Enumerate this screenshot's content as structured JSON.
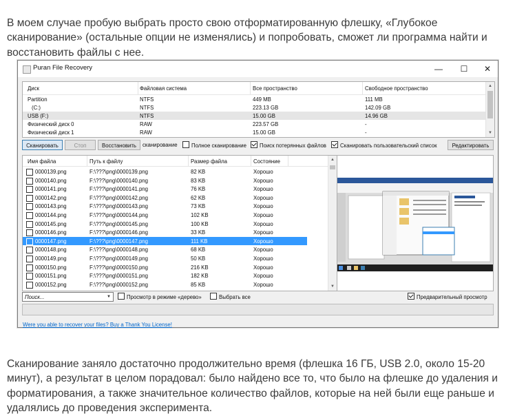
{
  "article": {
    "paragraph_1": "В моем случае пробую выбрать просто свою отформатированную флешку, «Глубокое сканирование» (остальные опции не изменялись) и попробовать, сможет ли программа найти и восстановить файлы с нее.",
    "paragraph_2": "Сканирование заняло достаточно продолжительно время (флешка 16 ГБ, USB 2.0, около 15-20 минут), а результат в целом порадовал: было найдено все то, что было на флешке до удаления и форматирования, а также значительное количество файлов, которые на ней были еще раньше и удалялись до проведения эксперимента."
  },
  "window": {
    "title": "Puran File Recovery",
    "minimize": "—",
    "maximize": "☐",
    "close": "✕"
  },
  "drives": {
    "columns": [
      "Диск",
      "Файловая система",
      "Все пространство",
      "Свободное пространство"
    ],
    "rows": [
      {
        "disk": "Partition",
        "fs": "NTFS",
        "total": "449 MB",
        "free": "111 MB"
      },
      {
        "disk": "(C:)",
        "fs": "NTFS",
        "total": "223.13 GB",
        "free": "142.09 GB"
      },
      {
        "disk": "USB (F:)",
        "fs": "NTFS",
        "total": "15.00 GB",
        "free": "14.96 GB"
      },
      {
        "disk": "Физический диск 0",
        "fs": "RAW",
        "total": "223.57 GB",
        "free": "-"
      },
      {
        "disk": "Физический диск 1",
        "fs": "RAW",
        "total": "15.00 GB",
        "free": "-"
      }
    ]
  },
  "toolbar": {
    "scan": "Сканировать",
    "stop": "Стоп",
    "restore": "Восстановить",
    "deep_scan": "сканирование",
    "full_scan": "Полное сканирование",
    "lost_files": "Поиск потерянных файлов",
    "custom_list": "Сканировать пользовательский список",
    "edit": "Редактировать"
  },
  "files": {
    "columns": [
      "Имя файла",
      "Путь к файлу",
      "Размер файла",
      "Состояние"
    ],
    "rows": [
      {
        "name": "0000139.png",
        "path": "F:\\???\\png\\0000139.png",
        "size": "82 KB",
        "state": "Хорошо"
      },
      {
        "name": "0000140.png",
        "path": "F:\\???\\png\\0000140.png",
        "size": "83 KB",
        "state": "Хорошо"
      },
      {
        "name": "0000141.png",
        "path": "F:\\???\\png\\0000141.png",
        "size": "76 KB",
        "state": "Хорошо"
      },
      {
        "name": "0000142.png",
        "path": "F:\\???\\png\\0000142.png",
        "size": "62 KB",
        "state": "Хорошо"
      },
      {
        "name": "0000143.png",
        "path": "F:\\???\\png\\0000143.png",
        "size": "73 KB",
        "state": "Хорошо"
      },
      {
        "name": "0000144.png",
        "path": "F:\\???\\png\\0000144.png",
        "size": "102 KB",
        "state": "Хорошо"
      },
      {
        "name": "0000145.png",
        "path": "F:\\???\\png\\0000145.png",
        "size": "100 KB",
        "state": "Хорошо"
      },
      {
        "name": "0000146.png",
        "path": "F:\\???\\png\\0000146.png",
        "size": "33 KB",
        "state": "Хорошо"
      },
      {
        "name": "0000147.png",
        "path": "F:\\???\\png\\0000147.png",
        "size": "111 KB",
        "state": "Хорошо"
      },
      {
        "name": "0000148.png",
        "path": "F:\\???\\png\\0000148.png",
        "size": "68 KB",
        "state": "Хорошо"
      },
      {
        "name": "0000149.png",
        "path": "F:\\???\\png\\0000149.png",
        "size": "50 KB",
        "state": "Хорошо"
      },
      {
        "name": "0000150.png",
        "path": "F:\\???\\png\\0000150.png",
        "size": "216 KB",
        "state": "Хорошо"
      },
      {
        "name": "0000151.png",
        "path": "F:\\???\\png\\0000151.png",
        "size": "182 KB",
        "state": "Хорошо"
      },
      {
        "name": "0000152.png",
        "path": "F:\\???\\png\\0000152.png",
        "size": "85 KB",
        "state": "Хорошо"
      }
    ]
  },
  "bottom": {
    "search_placeholder": "Поиск...",
    "tree_view": "Просмотр в режиме «дерево»",
    "select_all": "Выбрать все",
    "preview": "Предварительный просмотр",
    "thanks_link": "Were you able to recover your files? Buy a Thank You License!"
  },
  "colors": {
    "selection": "#3399ff",
    "link": "#0066cc"
  }
}
